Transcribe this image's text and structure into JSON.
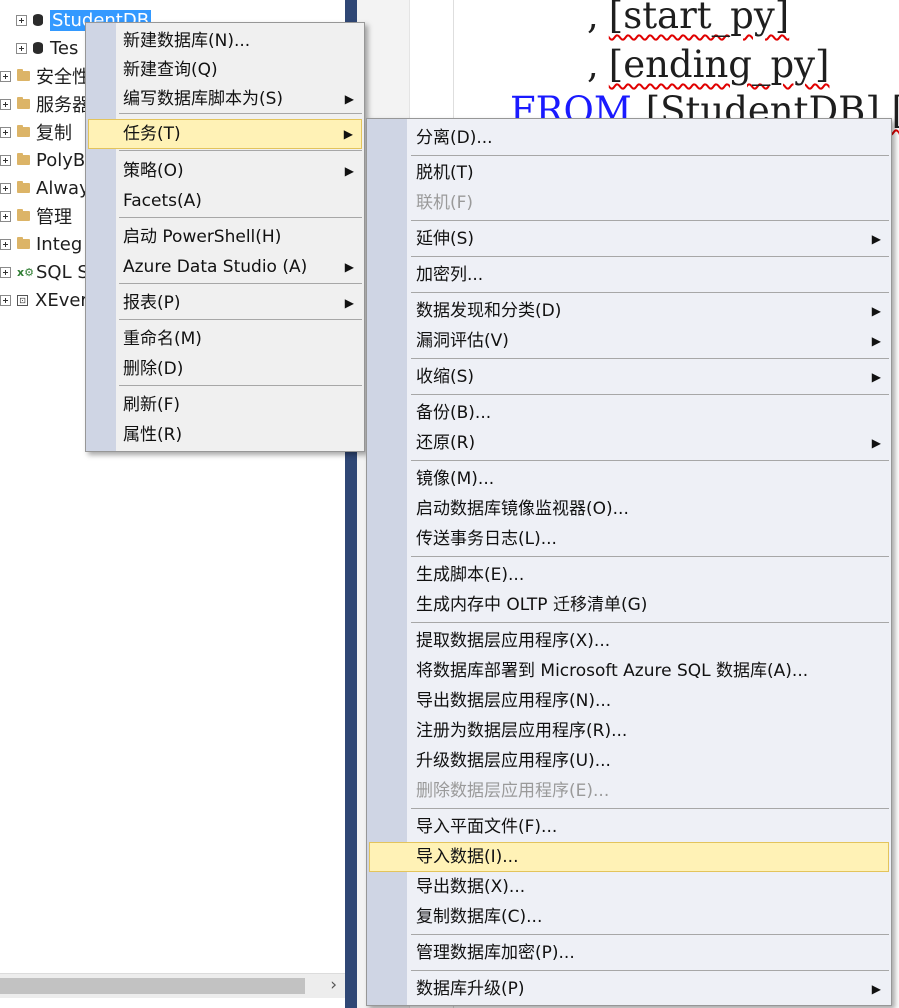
{
  "explorer": {
    "nodes": [
      {
        "label": "StudentDB",
        "kind": "db",
        "selected": true
      },
      {
        "label": "Tes",
        "kind": "db"
      },
      {
        "label": "安全性",
        "kind": "folder"
      },
      {
        "label": "服务器",
        "kind": "folder"
      },
      {
        "label": "复制",
        "kind": "folder"
      },
      {
        "label": "PolyB",
        "kind": "folder"
      },
      {
        "label": "Alway",
        "kind": "folder"
      },
      {
        "label": "管理",
        "kind": "folder"
      },
      {
        "label": "Integ",
        "kind": "folder"
      },
      {
        "label": "SQL S",
        "kind": "agent"
      },
      {
        "label": "XEver",
        "kind": "xevent"
      }
    ],
    "scroll_right_glyph": "›"
  },
  "editor": {
    "lines": [
      {
        "prefix": ",",
        "ident": "[start_py]"
      },
      {
        "prefix": ",",
        "ident": "[ending_py]"
      },
      {
        "keyword": "FROM",
        "ident": "[StudentDB].[db"
      }
    ]
  },
  "context_menu": {
    "items": [
      {
        "label": "新建数据库(N)..."
      },
      {
        "label": "新建查询(Q)"
      },
      {
        "label": "编写数据库脚本为(S)",
        "submenu": true
      },
      {
        "label": "任务(T)",
        "submenu": true,
        "highlighted": true
      },
      {
        "label": "策略(O)",
        "submenu": true
      },
      {
        "label": "Facets(A)"
      },
      {
        "label": "启动 PowerShell(H)"
      },
      {
        "label": "Azure Data Studio (A)",
        "submenu": true
      },
      {
        "label": "报表(P)",
        "submenu": true
      },
      {
        "label": "重命名(M)"
      },
      {
        "label": "删除(D)"
      },
      {
        "label": "刷新(F)"
      },
      {
        "label": "属性(R)"
      }
    ]
  },
  "tasks_menu": {
    "items": [
      {
        "label": "分离(D)..."
      },
      {
        "label": "脱机(T)"
      },
      {
        "label": "联机(F)",
        "disabled": true
      },
      {
        "label": "延伸(S)",
        "submenu": true
      },
      {
        "label": "加密列..."
      },
      {
        "label": "数据发现和分类(D)",
        "submenu": true
      },
      {
        "label": "漏洞评估(V)",
        "submenu": true
      },
      {
        "label": "收缩(S)",
        "submenu": true
      },
      {
        "label": "备份(B)..."
      },
      {
        "label": "还原(R)",
        "submenu": true
      },
      {
        "label": "镜像(M)..."
      },
      {
        "label": "启动数据库镜像监视器(O)..."
      },
      {
        "label": "传送事务日志(L)..."
      },
      {
        "label": "生成脚本(E)..."
      },
      {
        "label": "生成内存中 OLTP 迁移清单(G)"
      },
      {
        "label": "提取数据层应用程序(X)..."
      },
      {
        "label": "将数据库部署到 Microsoft Azure SQL 数据库(A)..."
      },
      {
        "label": "导出数据层应用程序(N)..."
      },
      {
        "label": "注册为数据层应用程序(R)..."
      },
      {
        "label": "升级数据层应用程序(U)..."
      },
      {
        "label": "删除数据层应用程序(E)...",
        "disabled": true
      },
      {
        "label": "导入平面文件(F)..."
      },
      {
        "label": "导入数据(I)...",
        "highlighted": true
      },
      {
        "label": "导出数据(X)..."
      },
      {
        "label": "复制数据库(C)..."
      },
      {
        "label": "管理数据库加密(P)..."
      },
      {
        "label": "数据库升级(P)",
        "submenu": true
      }
    ]
  },
  "colors": {
    "selection": "#3399ff",
    "menu_highlight": "#fff2b6",
    "keyword": "#1a1aff",
    "splitter": "#2f4775"
  },
  "submenu_arrow_icon": "▶"
}
